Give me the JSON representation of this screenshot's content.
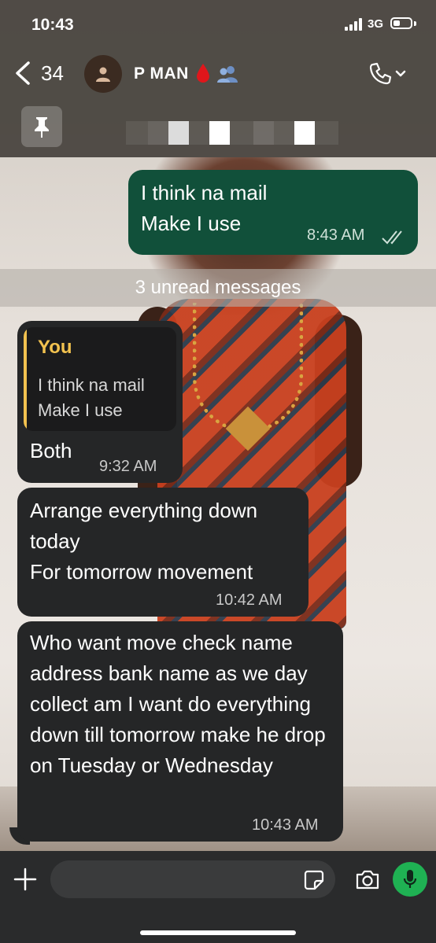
{
  "status_bar": {
    "time": "10:43",
    "network": "3G"
  },
  "header": {
    "back_count": "34",
    "contact_name": "P MAN",
    "icons": [
      "back-chevron-icon",
      "person-icon",
      "blood-drop-icon",
      "group-icon",
      "phone-icon",
      "chevron-down-icon"
    ]
  },
  "pinned": {
    "icon": "pin-icon"
  },
  "messages": [
    {
      "direction": "outgoing",
      "text": "I think na mail\nMake I use",
      "time": "8:43 AM",
      "status_icon": "double-check-icon"
    },
    {
      "direction": "incoming",
      "quote": {
        "author": "You",
        "text": "I think na mail\nMake I use"
      },
      "text": "Both",
      "time": "9:32 AM"
    },
    {
      "direction": "incoming",
      "text": "Arrange everything down\ntoday\nFor tomorrow movement",
      "time": "10:42 AM"
    },
    {
      "direction": "incoming",
      "text": "Who want move check name address bank name as we day collect am I want do everything down till tomorrow make he drop on Tuesday or Wednesday",
      "time": "10:43 AM"
    }
  ],
  "unread_divider": "3 unread messages",
  "composer": {
    "input_value": "",
    "icons": [
      "plus-icon",
      "sticker-icon",
      "camera-icon",
      "microphone-icon"
    ]
  },
  "colors": {
    "outgoing_bubble": "#11503a",
    "incoming_bubble": "#252627",
    "quote_accent": "#f2c24f",
    "mic_green": "#1fb153"
  }
}
